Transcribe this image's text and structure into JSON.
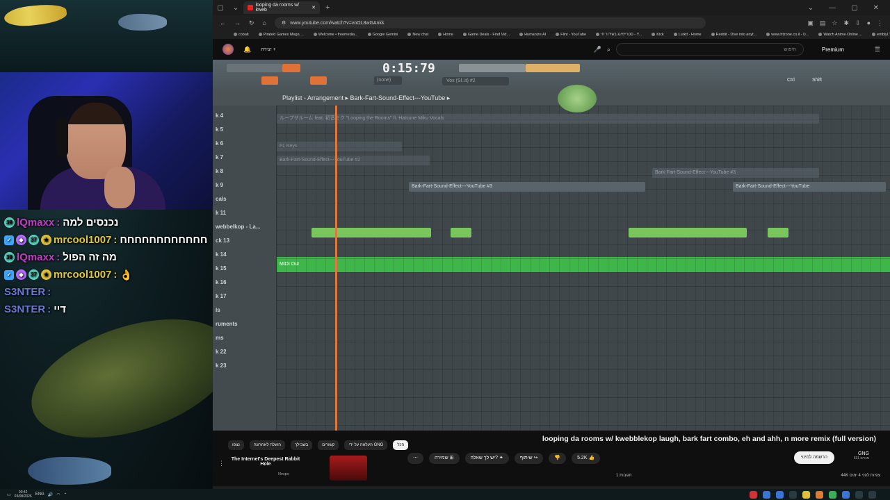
{
  "chat": [
    {
      "user": "lQmaxx",
      "user_color": "#c23cc4",
      "badges": [
        "sub"
      ],
      "sub_num": "39",
      "sep": ":",
      "text": "נכנסים למה"
    },
    {
      "user": "mrcool1007",
      "user_color": "#e3c83c",
      "badges": [
        "mod",
        "vip",
        "sub",
        "gold"
      ],
      "sub_num": "37",
      "sep": ":",
      "text": "חחחחחחחחחחחח"
    },
    {
      "user": "lQmaxx",
      "user_color": "#c23cc4",
      "badges": [
        "sub"
      ],
      "sub_num": "39",
      "sep": ":",
      "text": "מה זה הפול"
    },
    {
      "user": "mrcool1007",
      "user_color": "#e3c83c",
      "badges": [
        "mod",
        "vip",
        "sub",
        "gold"
      ],
      "sub_num": "37",
      "sep": ":",
      "text": "👌"
    },
    {
      "user": "S3NTER",
      "user_color": "#6a78d6",
      "badges": [],
      "sub_num": "",
      "sep": ":",
      "text": ""
    },
    {
      "user": "S3NTER",
      "user_color": "#6a78d6",
      "badges": [],
      "sub_num": "",
      "sep": ":",
      "text": "דיי"
    }
  ],
  "browser": {
    "tab_title": "looping da rooms w/ kweb",
    "url": "www.youtube.com/watch?v=voOL8wGAnkk",
    "bookmarks": [
      "cobalt",
      "Pirated Games Mega ...",
      "Welcome • freemedia...",
      "Google Gemini",
      "New chat",
      "Home",
      "Game Deals - Find Vid...",
      "Humanize AI",
      "Flint - YouTube",
      "סטריימינג בשידור חי - Y...",
      "Kick",
      "Lurkit - Home",
      "Reddit - Dive into anyt...",
      "www.htzone.co.il - ס...",
      "Watch Anime Online ...",
      "emblyl.TV"
    ]
  },
  "youtube": {
    "create_label": "יצירה",
    "search_placeholder": "חיפוש",
    "logo_label": "Premium",
    "video_title": "looping da rooms w/ kwebblekop laugh, bark fart combo, eh and ahh, n more remix (full version)",
    "chips": [
      "הכל",
      "העלאה על ידי GNG",
      "קשורים",
      "בשבילך",
      "הועלה לאחרונה",
      "נצפו"
    ],
    "actions": {
      "like_count": "5.2K",
      "share": "שיתוף",
      "ask": "יש לך שאלה?",
      "save": "שמירה"
    },
    "subscribe_label": "הרשמה למינוי",
    "channel_name": "GNG",
    "channel_subs": "631 מנויים",
    "views_info": "44K צפיות לפני 4 ימים",
    "comments_info": "1 תגובות",
    "rec_title": "The Internet's Deepest Rabbit Hole",
    "rec_channel": "Nexpo"
  },
  "flstudio": {
    "time": "0:15:79",
    "pattern_label": "Vox (Sl..it) #2",
    "none_label": "(none)",
    "breadcrumb": "Playlist - Arrangement  ▸  Bark-Fart-Sound-Effect---YouTube  ▸",
    "ctrl_label": "Ctrl",
    "shift_label": "Shift",
    "overlay_multiplier": "x2",
    "track_labels": [
      "k 4",
      "k 5",
      "k 6",
      "k 7",
      "k 8",
      "k 9",
      "cals",
      "k 11",
      "webbelkop - La...",
      "ck 13",
      "k 14",
      "k 15",
      "k 16",
      "k 17",
      "ls",
      "ruments",
      "ms",
      "k 22",
      "k 23"
    ],
    "clips": {
      "c1": "ループザルーム feat. 初音ミク \"Looping the Rooms\" ft. Hatsune Miku Vocals",
      "c2": "FL Keys",
      "c3": "Bark-Fart-Sound-Effect---YouTube #2",
      "c4": "Bark-Fart-Sound-Effect---YouTube #3",
      "c5": "Bark-Fart-Sound-Effect---YouTube #3",
      "c6": "Bark-Fart-Sound-Effect---YouTube",
      "c7": "MIDI Out"
    }
  },
  "taskbar": {
    "time": "00:42",
    "date": "03/08/2026",
    "lang": "ENG"
  }
}
